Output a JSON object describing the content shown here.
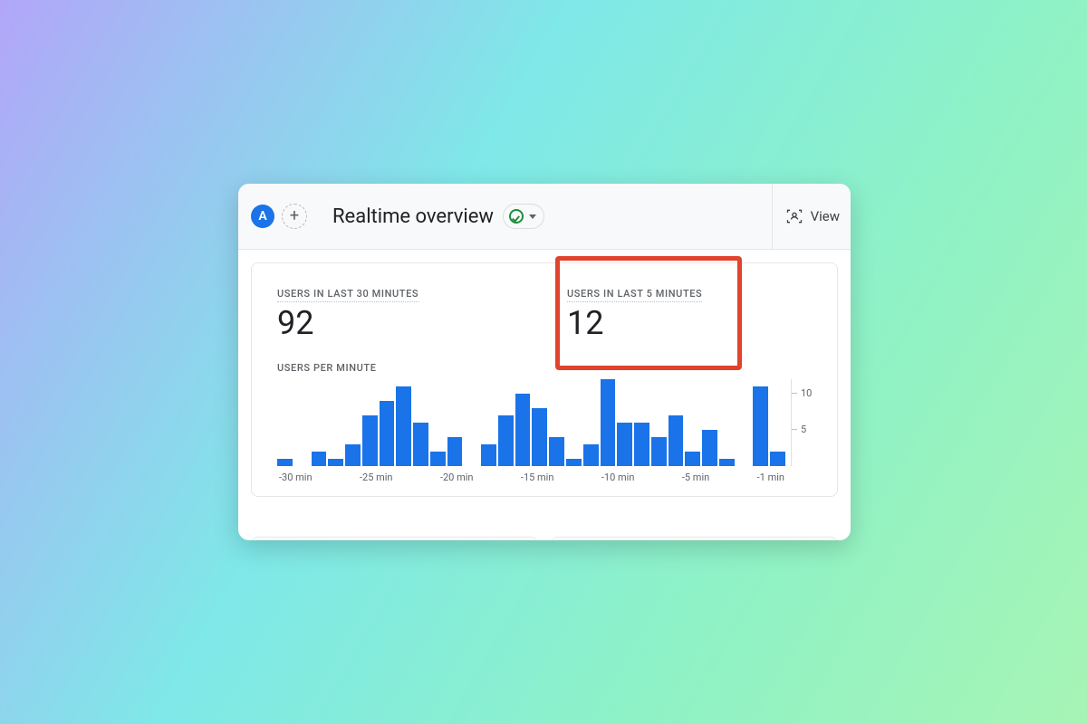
{
  "header": {
    "segment_chip": "A",
    "title": "Realtime overview",
    "view_label": "View"
  },
  "metrics": {
    "last30_label": "USERS IN LAST 30 MINUTES",
    "last30_value": "92",
    "last5_label": "USERS IN LAST 5 MINUTES",
    "last5_value": "12",
    "per_minute_label": "USERS PER MINUTE"
  },
  "chart_data": {
    "type": "bar",
    "categories": [
      -30,
      -29,
      -28,
      -27,
      -26,
      -25,
      -24,
      -23,
      -22,
      -21,
      -20,
      -19,
      -18,
      -17,
      -16,
      -15,
      -14,
      -13,
      -12,
      -11,
      -10,
      -9,
      -8,
      -7,
      -6,
      -5,
      -4,
      -3,
      -2,
      -1
    ],
    "values": [
      1,
      0,
      2,
      1,
      3,
      7,
      9,
      11,
      6,
      2,
      4,
      0,
      3,
      7,
      10,
      8,
      4,
      1,
      3,
      12,
      6,
      6,
      4,
      7,
      2,
      5,
      1,
      0,
      11,
      2
    ],
    "title": "USERS PER MINUTE",
    "xlabel": "",
    "ylabel": "",
    "ylim": [
      0,
      12
    ],
    "yticks": [
      5,
      10
    ],
    "xticks": [
      "-30 min",
      "-25 min",
      "-20 min",
      "-15 min",
      "-10 min",
      "-5 min",
      "-1 min"
    ]
  },
  "colors": {
    "brand_blue": "#1a73e8",
    "status_green": "#1e8e3e",
    "highlight_red": "#e1432c"
  }
}
